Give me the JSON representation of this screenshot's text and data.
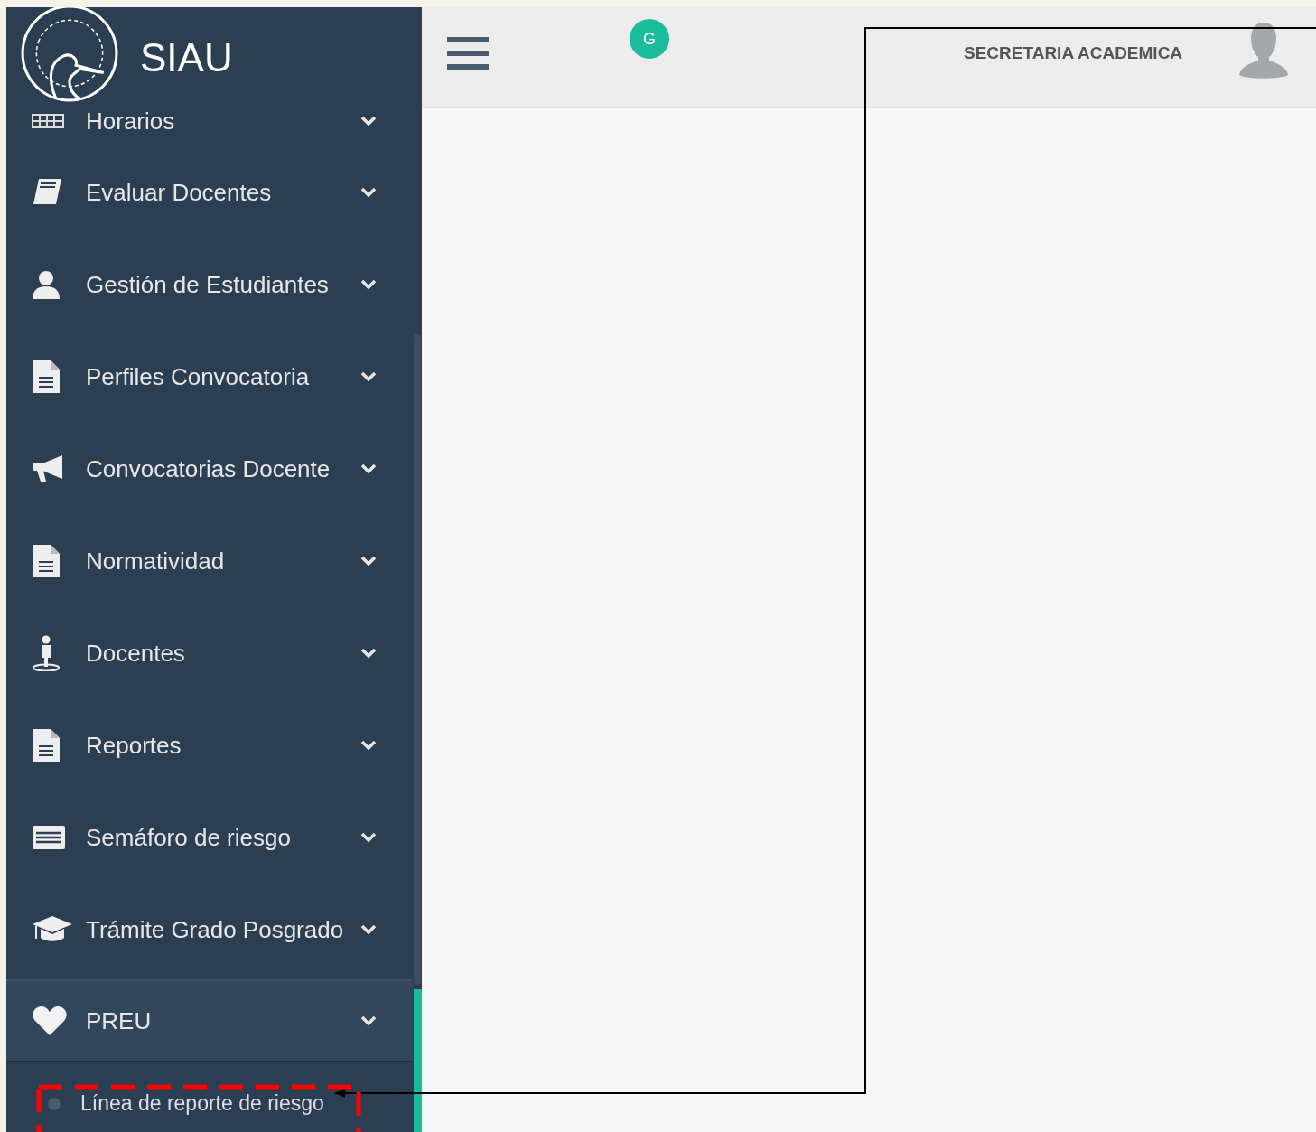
{
  "sidebar": {
    "brand": "SIAU",
    "items": [
      {
        "label": "Horarios",
        "kind": "calendar",
        "selected": false
      },
      {
        "label": "Evaluar Docentes",
        "kind": "book",
        "selected": false
      },
      {
        "label": "Gestión de Estudiantes",
        "kind": "user",
        "selected": false
      },
      {
        "label": "Perfiles Convocatoria",
        "kind": "file",
        "selected": false
      },
      {
        "label": "Convocatorias Docente",
        "kind": "bullhorn",
        "selected": false
      },
      {
        "label": "Normatividad",
        "kind": "file",
        "selected": false
      },
      {
        "label": "Docentes",
        "kind": "person",
        "selected": false
      },
      {
        "label": "Reportes",
        "kind": "file",
        "selected": false
      },
      {
        "label": "Semáforo de riesgo",
        "kind": "list",
        "selected": false
      },
      {
        "label": "Trámite Grado Posgrado",
        "kind": "cap",
        "selected": false
      },
      {
        "label": "PREU",
        "kind": "heart",
        "selected": true,
        "children": [
          {
            "label": "Línea de reporte de riesgo"
          }
        ]
      }
    ]
  },
  "header": {
    "badge": "G",
    "user": "SECRETARIA ACADEMICA"
  }
}
